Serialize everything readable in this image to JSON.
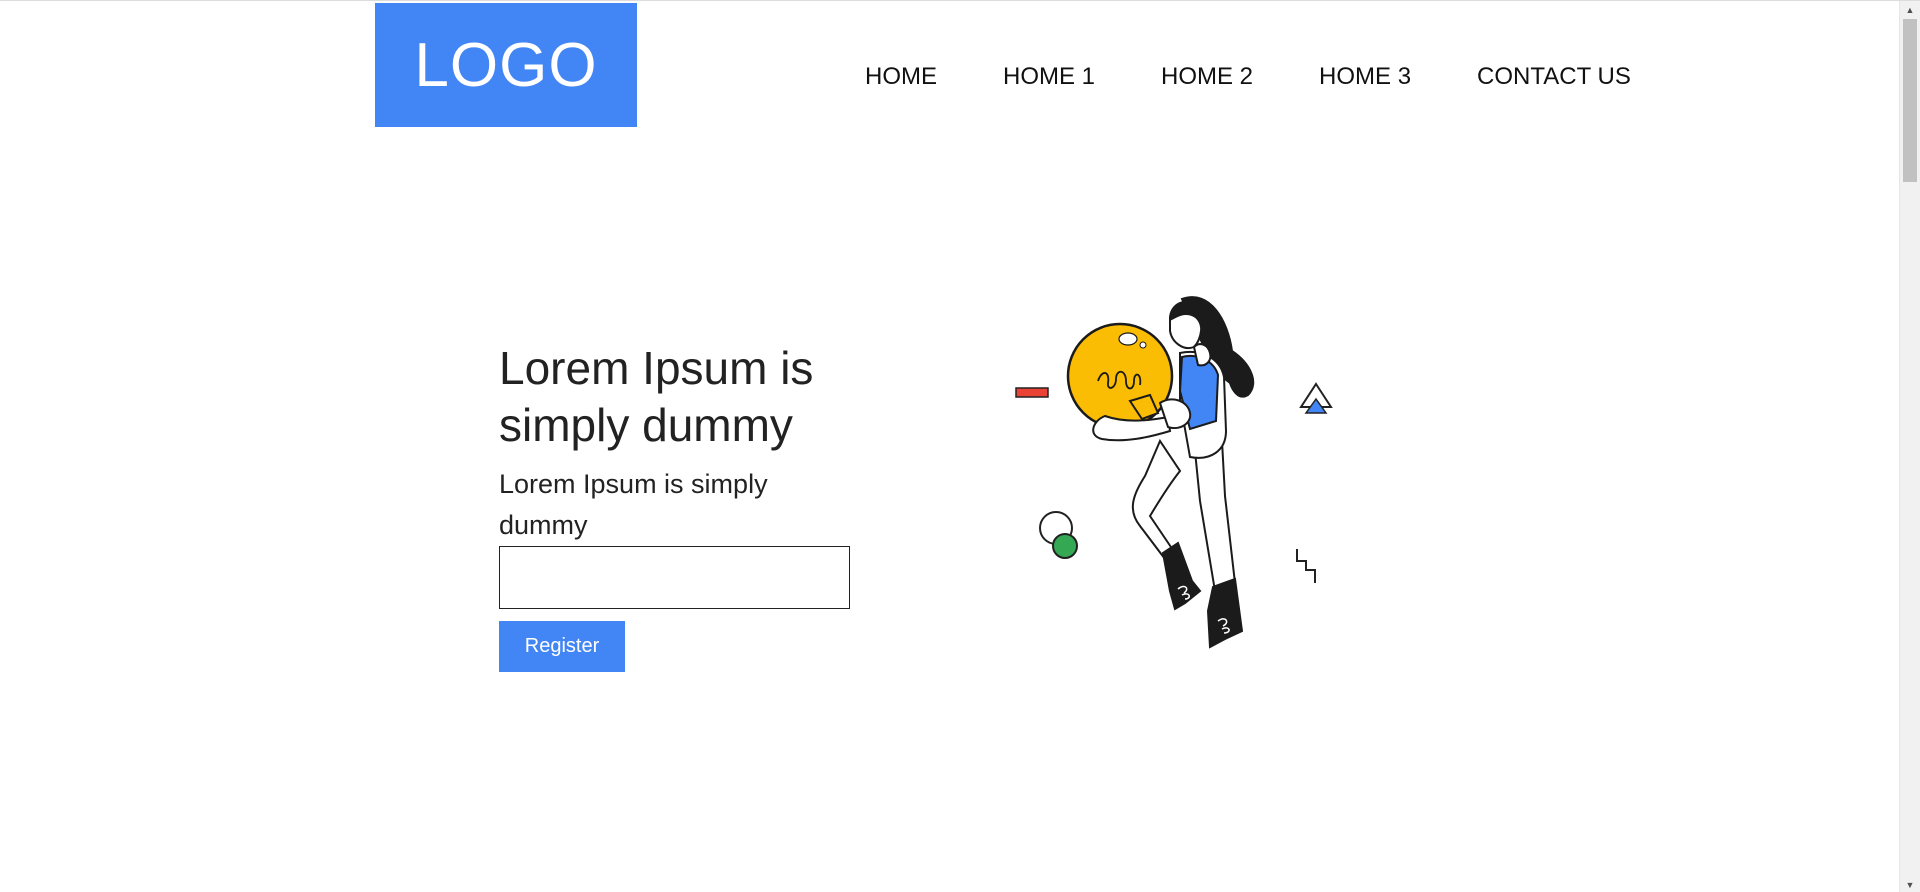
{
  "header": {
    "logo_text": "LOGO",
    "nav": [
      {
        "label": "HOME"
      },
      {
        "label": "HOME 1"
      },
      {
        "label": "HOME 2"
      },
      {
        "label": "HOME 3"
      },
      {
        "label": "CONTACT US"
      }
    ]
  },
  "hero": {
    "title": "Lorem Ipsum is simply dummy",
    "subtitle": "Lorem Ipsum is simply dummy",
    "input_value": "",
    "register_label": "Register"
  },
  "illustration": {
    "icon": "woman-holding-lightbulb-illustration"
  },
  "colors": {
    "accent": "#4285f4",
    "bulb": "#fbbc04",
    "green": "#34a853",
    "red": "#ea4335"
  }
}
